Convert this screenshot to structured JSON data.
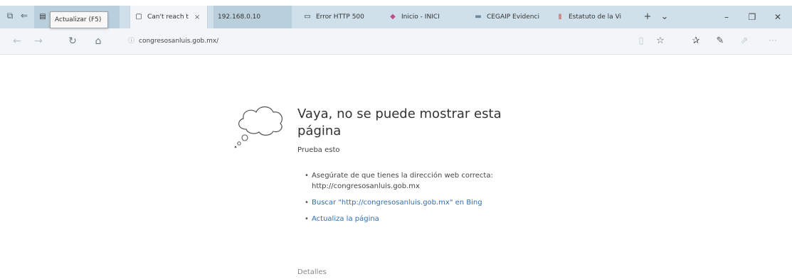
{
  "tabbar": {
    "tooltip": "Actualizar (F5)",
    "tabs": [
      {
        "label": "Can't reach t",
        "active": true,
        "close": "×"
      },
      {
        "label": "192.168.0.10",
        "active": false
      },
      {
        "label": "Error HTTP 500",
        "active": false
      },
      {
        "label": "Inicio - INICI",
        "active": false
      },
      {
        "label": "CEGAIP Evidenci",
        "active": false
      },
      {
        "label": "Estatuto de la Vi",
        "active": false
      }
    ],
    "new_tab": "+",
    "tab_menu": "⌄",
    "window": {
      "minimize": "–",
      "maximize": "❐",
      "close": "✕"
    }
  },
  "navbar": {
    "address": "congresosanluis.gob.mx/"
  },
  "error_page": {
    "title": "Vaya, no se puede mostrar esta página",
    "subtitle": "Prueba esto",
    "suggestions": [
      "Asegúrate de que tienes la dirección web correcta: http://congresosanluis.gob.mx",
      "Buscar \"http://congresosanluis.gob.mx\" en Bing",
      "Actualiza la página"
    ],
    "details": "Detalles"
  },
  "colors": {
    "tab_strip": "#cfe0ea",
    "link": "#2f6fb3"
  }
}
